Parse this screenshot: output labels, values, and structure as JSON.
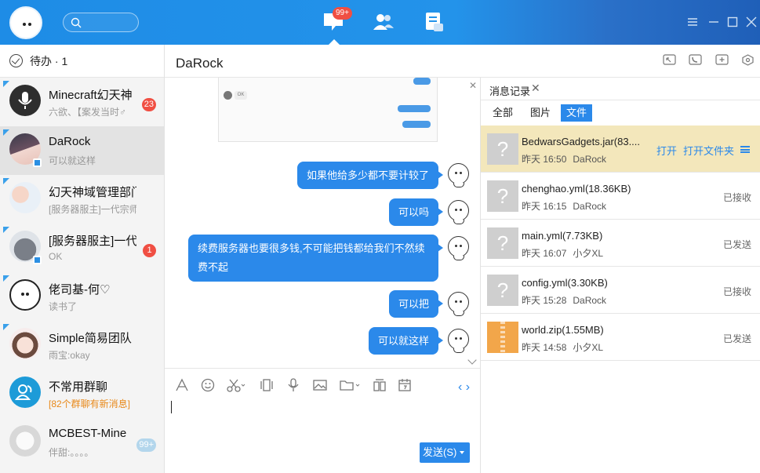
{
  "app": {
    "unread_badge": "99+"
  },
  "left": {
    "todo_label": "待办 · 1",
    "contacts": [
      {
        "name": "Minecraft幻天神",
        "sub": "六欲、【案发当时♂",
        "badge": "23"
      },
      {
        "name": "DaRock",
        "sub": "可以就这样",
        "badge": ""
      },
      {
        "name": "幻天神域管理部门群",
        "sub": "[服务器服主]一代宗师:@:",
        "badge": ""
      },
      {
        "name": "[服务器服主]一代",
        "sub": "OK",
        "badge": "1"
      },
      {
        "name": "佬司基-何♡",
        "sub": "读书了",
        "badge": ""
      },
      {
        "name": "Simple简易团队",
        "sub": "雨宝:okay",
        "badge": ""
      },
      {
        "name": "不常用群聊",
        "sub": "[82个群聊有新消息]",
        "badge": ""
      },
      {
        "name": "MCBEST-Mine",
        "sub": "伴甜:。。。。",
        "badge": "99+"
      }
    ]
  },
  "chat": {
    "title": "DaRock",
    "screenshot_text": "OK",
    "messages": [
      "如果他给多少都不要计较了",
      "可以吗",
      "续费服务器也要很多钱,不可能把钱都给我们不然续费不起",
      "可以把",
      "可以就这样"
    ],
    "send_label": "发送(S)",
    "toolbar_icons": [
      "font-icon",
      "emoji-icon",
      "scissors-icon",
      "shake-icon",
      "voice-icon",
      "image-icon",
      "folder-icon",
      "gift-icon",
      "calendar-icon"
    ]
  },
  "panel": {
    "tab_label": "消息记录",
    "filters": [
      "全部",
      "图片",
      "文件"
    ],
    "files": [
      {
        "name": "BedwarsGadgets.jar(83....",
        "time": "昨天 16:50",
        "sender": "DaRock",
        "status": "",
        "open": "打开",
        "open_folder": "打开文件夹"
      },
      {
        "name": "chenghao.yml(18.36KB)",
        "time": "昨天 16:15",
        "sender": "DaRock",
        "status": "已接收"
      },
      {
        "name": "main.yml(7.73KB)",
        "time": "昨天 16:07",
        "sender": "小夕XL",
        "status": "已发送"
      },
      {
        "name": "config.yml(3.30KB)",
        "time": "昨天 15:28",
        "sender": "DaRock",
        "status": "已接收"
      },
      {
        "name": "world.zip(1.55MB)",
        "time": "昨天 14:58",
        "sender": "小夕XL",
        "status": "已发送"
      }
    ]
  },
  "colors": {
    "accent": "#2b89ea",
    "badge_red": "#f04f43",
    "selected_file": "#f3e7bb"
  }
}
